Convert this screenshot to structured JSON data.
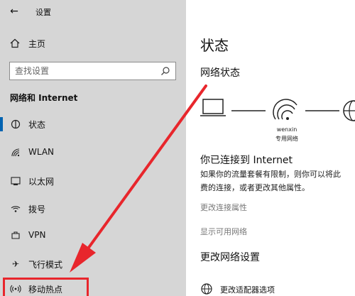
{
  "window": {
    "title": "设置"
  },
  "sidebar": {
    "home_label": "主页",
    "search_placeholder": "查找设置",
    "section_title": "网络和 Internet",
    "items": [
      {
        "label": "状态",
        "icon": "status-icon",
        "selected": true
      },
      {
        "label": "WLAN",
        "icon": "wifi-icon",
        "selected": false
      },
      {
        "label": "以太网",
        "icon": "ethernet-icon",
        "selected": false
      },
      {
        "label": "拨号",
        "icon": "dialup-icon",
        "selected": false
      },
      {
        "label": "VPN",
        "icon": "vpn-icon",
        "selected": false
      },
      {
        "label": "飞行模式",
        "icon": "airplane-icon",
        "selected": false
      },
      {
        "label": "移动热点",
        "icon": "hotspot-icon",
        "selected": false
      }
    ]
  },
  "main": {
    "page_title": "状态",
    "network_status_title": "网络状态",
    "wifi_name": "wenxin",
    "wifi_type": "专用网络",
    "connected_title": "你已连接到 Internet",
    "connected_desc_line1": "如果你的流量套餐有限制，则你可以将此",
    "connected_desc_line2": "费的连接，或者更改其他属性。",
    "change_connection_props": "更改连接属性",
    "show_available_networks": "显示可用网络",
    "change_network_settings_title": "更改网络设置",
    "change_adapter_options": "更改适配器选项"
  },
  "colors": {
    "sidebar_bg": "#d6d6d6",
    "accent": "#0063b1",
    "annotation_red": "#e8262c"
  }
}
